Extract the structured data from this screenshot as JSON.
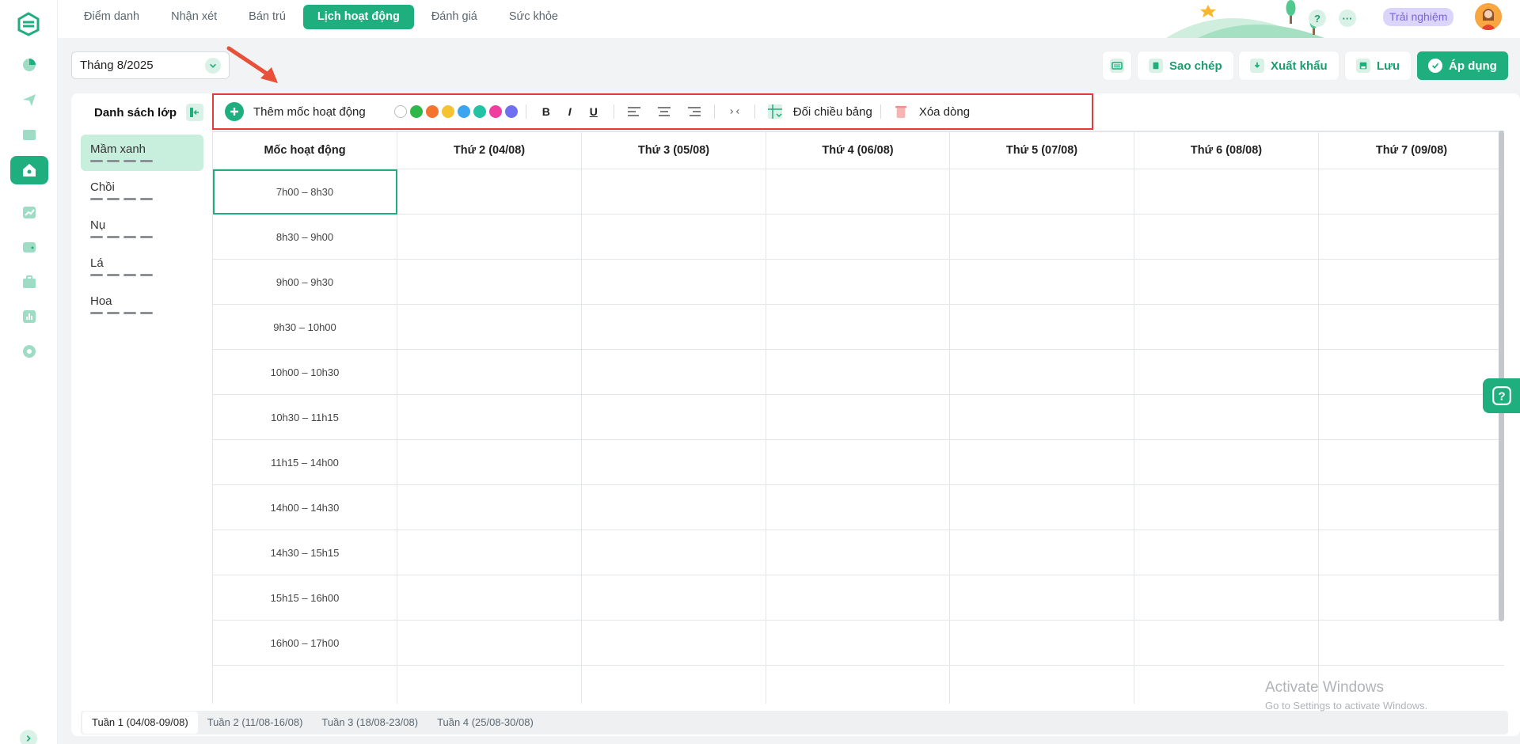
{
  "nav": {
    "tabs": [
      {
        "label": "Điểm danh"
      },
      {
        "label": "Nhận xét"
      },
      {
        "label": "Bán trú"
      },
      {
        "label": "Lịch hoạt động"
      },
      {
        "label": "Đánh giá"
      },
      {
        "label": "Sức khỏe"
      }
    ],
    "active_tab": "Lịch hoạt động",
    "help_icon": "?",
    "more_icon": "···",
    "trial_label": "Trải nghiệm"
  },
  "toolbar": {
    "month_value": "Tháng 8/2025",
    "copy_label": "Sao chép",
    "export_label": "Xuất khẩu",
    "save_label": "Lưu",
    "apply_label": "Áp dụng"
  },
  "sidebar": {
    "title": "Danh sách lớp",
    "classes": [
      {
        "name": "Mầm xanh"
      },
      {
        "name": "Chồi"
      },
      {
        "name": "Nụ"
      },
      {
        "name": "Lá"
      },
      {
        "name": "Hoa"
      }
    ]
  },
  "format_bar": {
    "add_label": "Thêm mốc hoạt động",
    "colors": [
      "#ffffff",
      "#2fb84a",
      "#f4742f",
      "#f5c232",
      "#3aa5f0",
      "#22c3a2",
      "#ee3fa0",
      "#6f6ff0"
    ],
    "bold": "B",
    "italic": "I",
    "underline": "U",
    "swap_label": "Đối chiều bảng",
    "delete_label": "Xóa dòng"
  },
  "table": {
    "headers": [
      "Mốc hoạt động",
      "Thứ 2 (04/08)",
      "Thứ 3 (05/08)",
      "Thứ 4 (06/08)",
      "Thứ 5 (07/08)",
      "Thứ 6 (08/08)",
      "Thứ 7 (09/08)"
    ],
    "times": [
      "7h00 – 8h30",
      "8h30 – 9h00",
      "9h00 – 9h30",
      "9h30 – 10h00",
      "10h00 – 10h30",
      "10h30 – 11h15",
      "11h15 – 14h00",
      "14h00 – 14h30",
      "14h30 – 15h15",
      "15h15 – 16h00",
      "16h00 – 17h00"
    ]
  },
  "weeks": [
    {
      "label": "Tuần 1",
      "range": "(04/08-09/08)"
    },
    {
      "label": "Tuần 2",
      "range": "(11/08-16/08)"
    },
    {
      "label": "Tuần 3",
      "range": "(18/08-23/08)"
    },
    {
      "label": "Tuần 4",
      "range": "(25/08-30/08)"
    }
  ],
  "watermark": {
    "line1": "Activate Windows",
    "line2": "Go to Settings to activate Windows."
  },
  "colors": {
    "accent": "#1fae7e",
    "highlight_border": "#e23b3b"
  }
}
